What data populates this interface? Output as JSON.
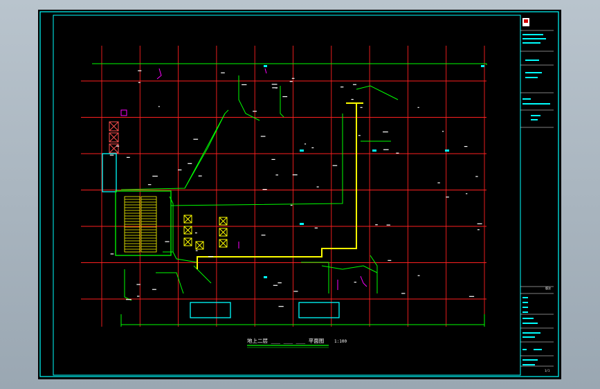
{
  "drawing": {
    "title": "地上二层 ___ ___ ___ 平面图",
    "scale": "1:100"
  },
  "grid": {
    "columns": 11,
    "rows": 7
  },
  "title_block": {
    "revision_header": "版次",
    "sheet_no": "1/1"
  },
  "colors": {
    "background": "#000000",
    "frame": "#00ffff",
    "grid_axis": "#ff0000",
    "wall": "#00ff00",
    "pipe_main": "#ffff00",
    "accent": "#ff00ff",
    "text": "#ffffff"
  }
}
